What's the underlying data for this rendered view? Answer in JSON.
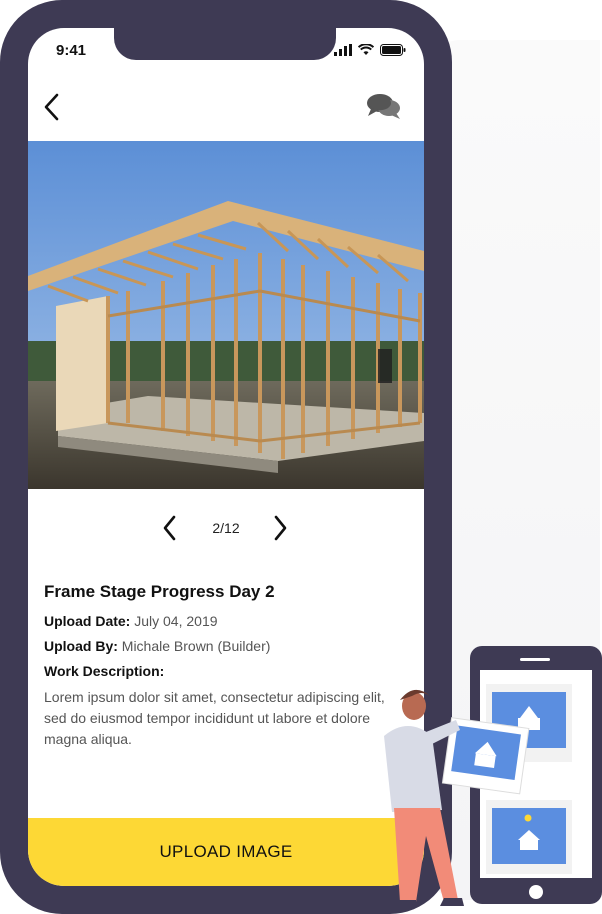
{
  "status_bar": {
    "time": "9:41"
  },
  "header": {
    "back_icon": "chevron-left-icon",
    "chat_icon": "chat-bubbles-icon"
  },
  "pager": {
    "current": 2,
    "total": 12,
    "text": "2/12"
  },
  "details": {
    "title": "Frame Stage Progress Day 2",
    "upload_date_label": "Upload Date:",
    "upload_date_value": "July 04, 2019",
    "upload_by_label": "Upload By:",
    "upload_by_value": "Michale Brown (Builder)",
    "work_description_label": "Work Description:",
    "work_description_value": "Lorem ipsum dolor sit amet, consectetur adipiscing elit, sed do eiusmod tempor incididunt ut labore et dolore magna aliqua."
  },
  "actions": {
    "upload_label": "UPLOAD IMAGE"
  },
  "colors": {
    "frame": "#3e3a54",
    "accent": "#fdd835",
    "sky": "#6f9bd8",
    "illustration_blue": "#5b8ee0"
  }
}
